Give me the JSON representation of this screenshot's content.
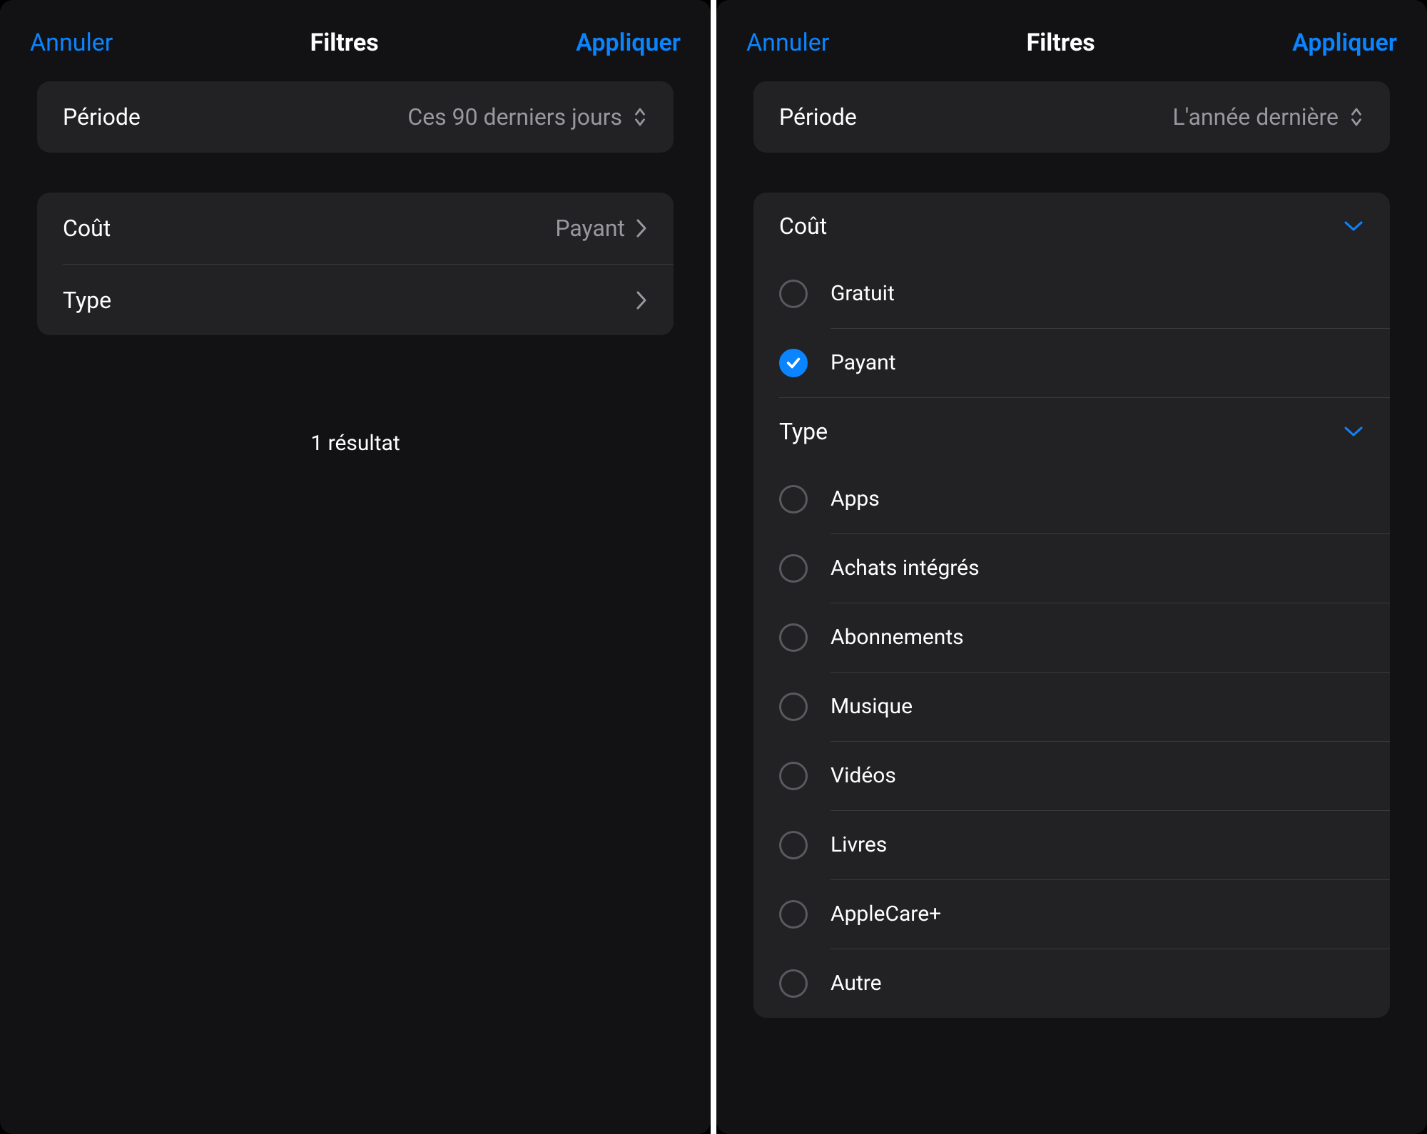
{
  "colors": {
    "accent": "#0a84ff",
    "muted": "#98989e"
  },
  "left": {
    "header": {
      "cancel": "Annuler",
      "title": "Filtres",
      "apply": "Appliquer"
    },
    "period": {
      "label": "Période",
      "value": "Ces 90 derniers jours"
    },
    "cost": {
      "label": "Coût",
      "value": "Payant"
    },
    "type": {
      "label": "Type"
    },
    "result": "1 résultat"
  },
  "right": {
    "header": {
      "cancel": "Annuler",
      "title": "Filtres",
      "apply": "Appliquer"
    },
    "period": {
      "label": "Période",
      "value": "L'année dernière"
    },
    "cost": {
      "label": "Coût",
      "options": [
        {
          "label": "Gratuit",
          "selected": false
        },
        {
          "label": "Payant",
          "selected": true
        }
      ]
    },
    "type": {
      "label": "Type",
      "options": [
        {
          "label": "Apps"
        },
        {
          "label": "Achats intégrés"
        },
        {
          "label": "Abonnements"
        },
        {
          "label": "Musique"
        },
        {
          "label": "Vidéos"
        },
        {
          "label": "Livres"
        },
        {
          "label": "AppleCare+"
        },
        {
          "label": "Autre"
        }
      ]
    }
  }
}
